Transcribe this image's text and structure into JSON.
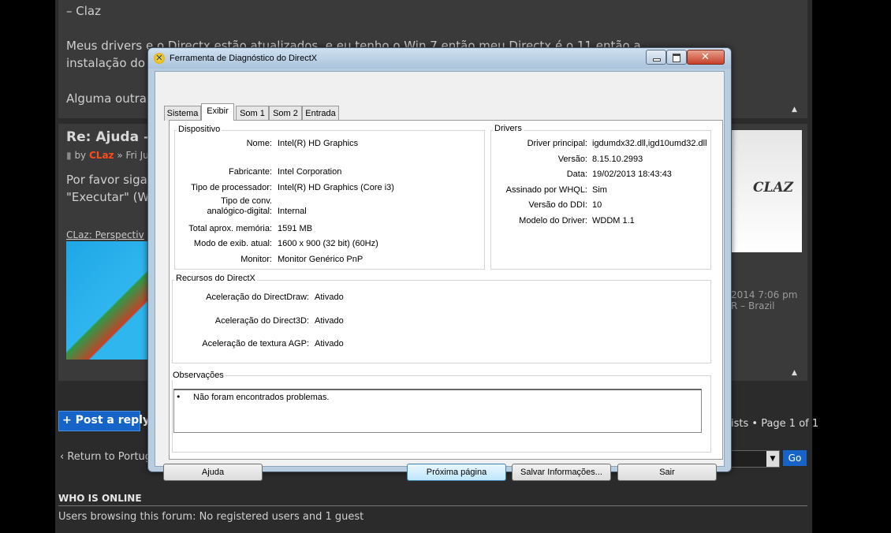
{
  "forum": {
    "quote_author": "– Claz",
    "post1_line1": "Meus drivers e o Directx estão atualizados, e eu tenho o Win 7 então meu Directx é o 11 então a",
    "post1_line2": "instalação do",
    "post1_line3": "Alguma outra s",
    "post2_title": "Re: Ajuda –",
    "post2_by": "by",
    "post2_author": "CLaz",
    "post2_date": "» Fri Jul",
    "post2_line1": "Por favor siga",
    "post2_line2": "\"Executar\" (Wi",
    "signature_link": "CLaz: Perspectiv",
    "post_date_right": "2014 7:06 pm",
    "location_right": "R – Brazil",
    "avatar_text": "CLAZ",
    "post_reply_label": "+ Post a reply",
    "pagination": "ists • Page 1 of 1",
    "return_link": "‹ Return to Portug",
    "go_button": "Go",
    "who_is_online_title": "WHO IS ONLINE",
    "who_is_online_text": "Users browsing this forum: No registered users and 1 guest"
  },
  "dialog": {
    "title": "Ferramenta de Diagnóstico do DirectX",
    "tabs": [
      "Sistema",
      "Exibir",
      "Som 1",
      "Som 2",
      "Entrada"
    ],
    "active_tab": "Exibir",
    "device": {
      "group_label": "Dispositivo",
      "fields": [
        {
          "label": "Nome:",
          "value": "Intel(R) HD Graphics"
        },
        {
          "label": "Fabricante:",
          "value": "Intel Corporation"
        },
        {
          "label": "Tipo de processador:",
          "value": "Intel(R) HD Graphics (Core i3)"
        },
        {
          "label_line1": "Tipo de conv.",
          "label_line2": "analógico-digital:",
          "value": "Internal"
        },
        {
          "label": "Total aprox. memória:",
          "value": "1591 MB"
        },
        {
          "label": "Modo de exib. atual:",
          "value": "1600 x 900 (32 bit) (60Hz)"
        },
        {
          "label": "Monitor:",
          "value": "Monitor Genérico PnP"
        }
      ]
    },
    "drivers": {
      "group_label": "Drivers",
      "fields": [
        {
          "label": "Driver principal:",
          "value": "igdumdx32.dll,igd10umd32.dll"
        },
        {
          "label": "Versão:",
          "value": "8.15.10.2993"
        },
        {
          "label": "Data:",
          "value": "19/02/2013 18:43:43"
        },
        {
          "label": "Assinado por WHQL:",
          "value": "Sim"
        },
        {
          "label": "Versão do DDI:",
          "value": "10"
        },
        {
          "label": "Modelo do Driver:",
          "value": "WDDM 1.1"
        }
      ]
    },
    "directx_features": {
      "group_label": "Recursos do DirectX",
      "fields": [
        {
          "label": "Aceleração do DirectDraw:",
          "value": "Ativado"
        },
        {
          "label": "Aceleração do Direct3D:",
          "value": "Ativado"
        },
        {
          "label": "Aceleração de textura AGP:",
          "value": "Ativado"
        }
      ]
    },
    "notes": {
      "group_label": "Observações",
      "items": [
        "Não foram encontrados problemas."
      ]
    },
    "buttons": {
      "help": "Ajuda",
      "next_page": "Próxima página",
      "save_info": "Salvar Informações...",
      "exit": "Sair"
    }
  }
}
